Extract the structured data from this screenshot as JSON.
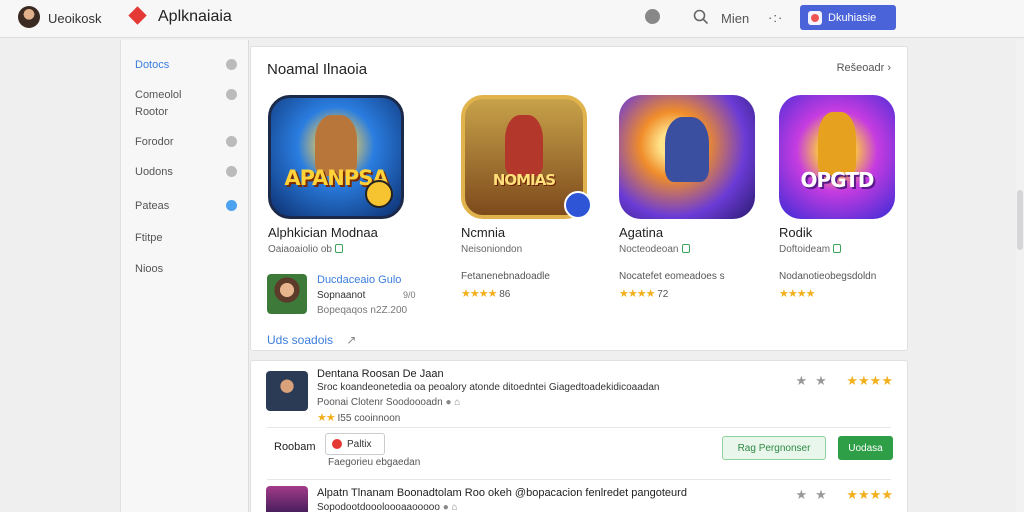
{
  "topbar": {
    "user_name": "Ueoikosk",
    "brand_name": "Aplknaiaia",
    "nav_label": "Mien",
    "cta_label": "Dkuhiasie"
  },
  "sidebar": {
    "items": [
      {
        "label": "Dotocs",
        "active": true
      },
      {
        "label": "Comeolol Rootor",
        "active": false
      },
      {
        "label": "Forodor",
        "active": false
      },
      {
        "label": "Uodons",
        "active": false
      },
      {
        "label": "Pateas",
        "active": false
      },
      {
        "label": "Ftitpe",
        "active": false
      },
      {
        "label": "Nioos",
        "active": false
      }
    ]
  },
  "featured": {
    "title": "Noamal Ilnaoia",
    "see_all": "Rešeoadr",
    "apps": [
      {
        "name": "Alphkician Modnaa",
        "subtitle": "Oaiaoaiolio ob",
        "icon_word": "APANPSA",
        "description": "",
        "rating_text": ""
      },
      {
        "name": "Ncmnia",
        "subtitle": "Neisoniondon",
        "icon_word": "NOMIAS",
        "description": "Fetanenebnadoadle",
        "rating_text": "86"
      },
      {
        "name": "Agatina",
        "subtitle": "Nocteodeoan",
        "icon_word": "",
        "description": "Nocatefet eomeadoes s",
        "rating_text": "72"
      },
      {
        "name": "Rodik",
        "subtitle": "Doftoideam",
        "icon_word": "OPGTD",
        "description": "Nodanotieobegsdoldn",
        "rating_text": ""
      }
    ],
    "mini": {
      "title": "Ducdaceaio Gulo",
      "subtitle": "Sopnaanot",
      "size": "9/0",
      "meta": "Bopeqaqos n2Z.200"
    },
    "more_link": "Uds soadois"
  },
  "list": {
    "rows": [
      {
        "title": "Dentana Roosan  Dе Jaan",
        "description": "Sroc koandeonetedia oa peoalory atonde ditoedntei Giagedtoadekidicoaadan",
        "meta": "Poonai  Clotenr Soodoooadn",
        "rating_text": "I55 cooinnoon"
      },
      {
        "title": "Alpatn Tlnanam Boonadtolam Roo okeh @bopacacion fenlredet pangoteurd",
        "description": "Sopodootdoooloooaaooooo",
        "meta": "",
        "rating_text": ""
      }
    ],
    "action_label": "Roobam",
    "chip_label": "Paltix",
    "chip_note": "Faegorieu ebgaedan",
    "outline_button": "Rag Pergnonser",
    "green_button": "Uodasa"
  },
  "colors": {
    "accent_blue": "#4a63d8",
    "link_blue": "#3b7ddd",
    "green": "#2e9e47",
    "star_gold": "#f2b01e"
  }
}
